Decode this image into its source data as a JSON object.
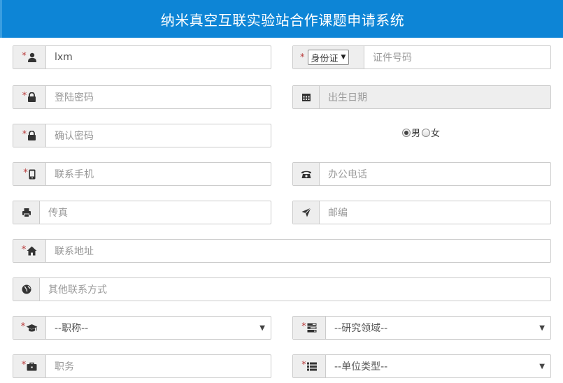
{
  "header": {
    "title": "纳米真空互联实验站合作课题申请系统"
  },
  "form": {
    "username": {
      "value": "lxm",
      "icon": "user-icon",
      "required": "*"
    },
    "id_type": {
      "selected": "身份证",
      "required": "*"
    },
    "id_number": {
      "placeholder": "证件号码"
    },
    "password": {
      "placeholder": "登陆密码",
      "icon": "lock-icon",
      "required": "*"
    },
    "birth_date": {
      "placeholder": "出生日期",
      "icon": "calendar-icon"
    },
    "confirm_password": {
      "placeholder": "确认密码",
      "icon": "lock-icon",
      "required": "*"
    },
    "gender": {
      "options": [
        "男",
        "女"
      ],
      "selected": "男"
    },
    "mobile": {
      "placeholder": "联系手机",
      "icon": "mobile-icon",
      "required": "*"
    },
    "office_phone": {
      "placeholder": "办公电话",
      "icon": "phone-icon"
    },
    "fax": {
      "placeholder": "传真",
      "icon": "printer-icon"
    },
    "postcode": {
      "placeholder": "邮编",
      "icon": "send-icon"
    },
    "address": {
      "placeholder": "联系地址",
      "icon": "home-icon",
      "required": "*"
    },
    "other_contact": {
      "placeholder": "其他联系方式",
      "icon": "globe-icon"
    },
    "title_select": {
      "selected": "--职称--",
      "icon": "graduation-cap-icon",
      "required": "*"
    },
    "research_field": {
      "selected": "--研究领域--",
      "icon": "tasks-icon",
      "required": "*"
    },
    "position": {
      "placeholder": "职务",
      "icon": "briefcase-icon",
      "required": "*"
    },
    "org_type": {
      "selected": "--单位类型--",
      "icon": "list-icon",
      "required": "*"
    }
  },
  "colors": {
    "header_bg": "#0d85d6",
    "required": "#b83a3a",
    "addon_bg": "#eeeeee",
    "border": "#cccccc"
  }
}
